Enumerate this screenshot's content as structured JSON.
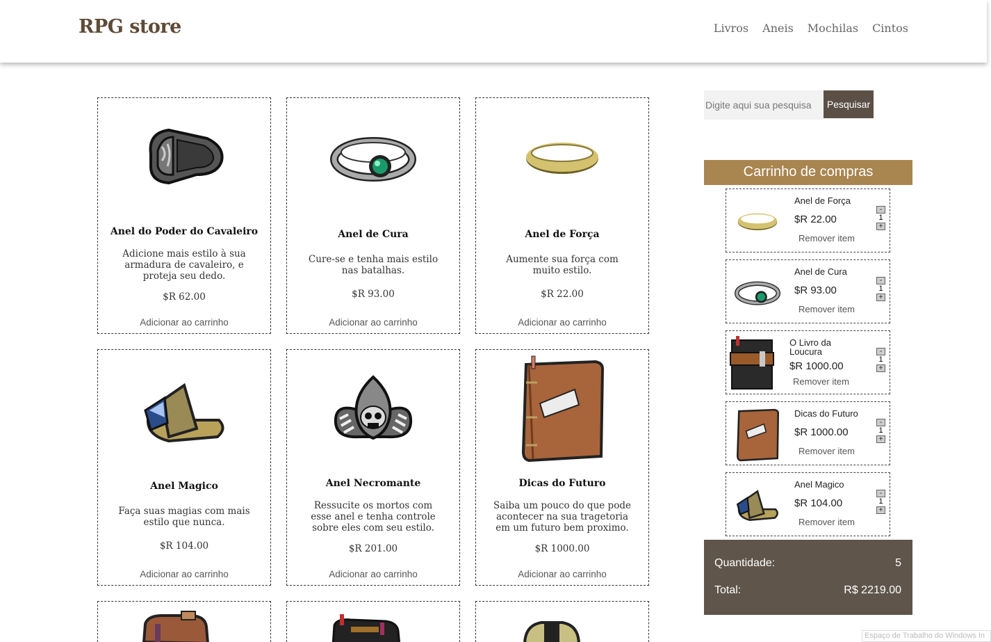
{
  "header": {
    "brand": "RPG store",
    "nav": [
      "Livros",
      "Aneis",
      "Mochilas",
      "Cintos"
    ]
  },
  "products": [
    {
      "name": "Anel do Poder do Cavaleiro",
      "desc": "Adicione mais estilo à sua armadura de cavaleiro, e proteja seu dedo.",
      "price": "$R 62.00",
      "add": "Adicionar ao carrinho",
      "icon": "knight-ring-icon"
    },
    {
      "name": "Anel de Cura",
      "desc": "Cure-se e tenha mais estilo nas batalhas.",
      "price": "$R 93.00",
      "add": "Adicionar ao carrinho",
      "icon": "emerald-ring-icon"
    },
    {
      "name": "Anel de Força",
      "desc": "Aumente sua força com muito estilo.",
      "price": "$R 22.00",
      "add": "Adicionar ao carrinho",
      "icon": "gold-ring-icon"
    },
    {
      "name": "Anel Magico",
      "desc": "Faça suas magias com mais estilo que nunca.",
      "price": "$R 104.00",
      "add": "Adicionar ao carrinho",
      "icon": "crystal-ring-icon"
    },
    {
      "name": "Anel Necromante",
      "desc": "Ressucite os mortos com esse anel e tenha controle sobre eles com seu estilo.",
      "price": "$R 201.00",
      "add": "Adicionar ao carrinho",
      "icon": "skull-ring-icon"
    },
    {
      "name": "Dicas do Futuro",
      "desc": "Saiba um pouco do que pode acontecer na sua tragetoria em um futuro bem proximo.",
      "price": "$R 1000.00",
      "add": "Adicionar ao carrinho",
      "icon": "brown-book-icon"
    }
  ],
  "search": {
    "placeholder": "Digite aqui sua pesquisa",
    "button": "Pesquisar"
  },
  "cart": {
    "title": "Carrinho de compras",
    "remove_label": "Remover item",
    "minus": "-",
    "plus": "+",
    "items": [
      {
        "name": "Anel de Força",
        "price": "$R 22.00",
        "qty": "1",
        "icon": "gold-ring-icon"
      },
      {
        "name": "Anel de Cura",
        "price": "$R 93.00",
        "qty": "1",
        "icon": "emerald-ring-icon"
      },
      {
        "name": "O Livro da Loucura",
        "price": "$R 1000.00",
        "qty": "1",
        "icon": "dark-book-icon"
      },
      {
        "name": "Dicas do Futuro",
        "price": "$R 1000.00",
        "qty": "1",
        "icon": "brown-book-icon"
      },
      {
        "name": "Anel Magico",
        "price": "$R 104.00",
        "qty": "1",
        "icon": "crystal-ring-icon"
      }
    ],
    "quantity_label": "Quantidade:",
    "quantity_value": "5",
    "total_label": "Total:",
    "total_value": "R$ 2219.00"
  },
  "watermark": "Espaço de Trabalho do Windows In",
  "colors": {
    "brand": "#5e4b36",
    "cart_header": "#a98550",
    "summary": "#5f554a",
    "search_button": "#5c5046"
  }
}
